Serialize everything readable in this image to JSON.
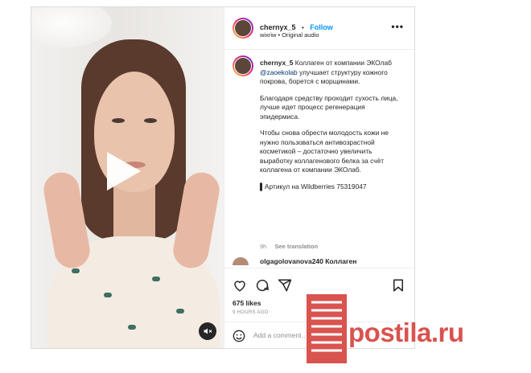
{
  "post": {
    "username": "chernyx_5",
    "dot": "•",
    "follow_label": "Follow",
    "audio": "wixriw • Original audio",
    "more_label": "•••",
    "caption_user": "chernyx_5",
    "caption_p1_a": "Коллаген от компании ЭКОлаб ",
    "caption_mention": "@zaoekolab",
    "caption_p1_b": " улучшает структуру кожного покрова, борется с морщинами.",
    "caption_p2": "Благодаря средству проходит сухость лица, лучше идет процесс регенерация эпидермиса.",
    "caption_p3": "Чтобы снова обрести молодость кожи не нужно пользоваться антивозрастной косметикой – достаточно увеличить выработку коллагенового белка за счёт коллагена от компании ЭКОлаб.",
    "caption_p4": "▌Артикул на Wildberries 75319047",
    "time_short": "9h",
    "see_translation": "See translation",
    "comment_peek": "olgagolovanova240 Коллаген",
    "likes": "675 likes",
    "time_ago": "9 HOURS AGO",
    "add_comment_placeholder": "Add a comment…"
  },
  "watermark": {
    "text": "postila.ru",
    "color": "#d9534f"
  },
  "icons": [
    "heart-icon",
    "comment-icon",
    "share-icon",
    "bookmark-icon",
    "emoji-icon",
    "mute-icon",
    "play-icon",
    "more-icon"
  ]
}
